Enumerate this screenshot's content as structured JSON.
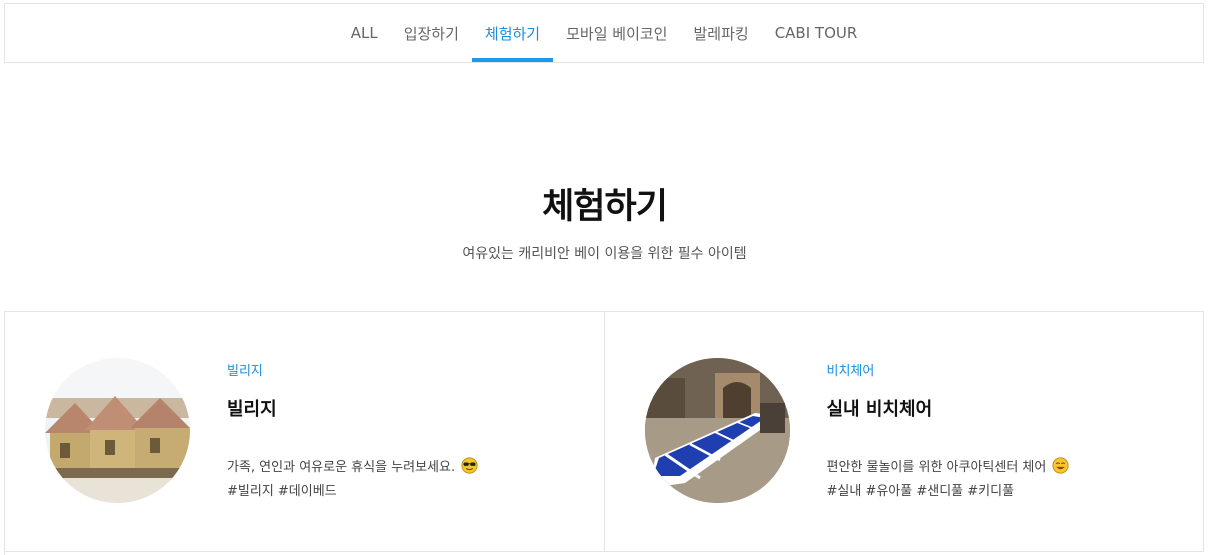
{
  "tabs": [
    {
      "label": "ALL",
      "active": false
    },
    {
      "label": "입장하기",
      "active": false
    },
    {
      "label": "체험하기",
      "active": true
    },
    {
      "label": "모바일 베이코인",
      "active": false
    },
    {
      "label": "발레파킹",
      "active": false
    },
    {
      "label": "CABI TOUR",
      "active": false
    }
  ],
  "hero": {
    "title": "체험하기",
    "subtitle": "여유있는 캐리비안 베이 이용을 위한 필수 아이템"
  },
  "cards": [
    {
      "category": "빌리지",
      "title": "빌리지",
      "description": "가족, 연인과 여유로운 휴식을 누려보세요.",
      "emoji": "sunglasses-face-icon",
      "tags": "#빌리지 #데이베드"
    },
    {
      "category": "비치체어",
      "title": "실내 비치체어",
      "description": "편안한 물놀이를 위한 아쿠아틱센터 체어",
      "emoji": "smiling-face-icon",
      "tags": "#실내 #유아풀 #샌디풀 #키디풀"
    }
  ],
  "colors": {
    "accent": "#1a9ae8",
    "border": "#e4e4e4"
  }
}
